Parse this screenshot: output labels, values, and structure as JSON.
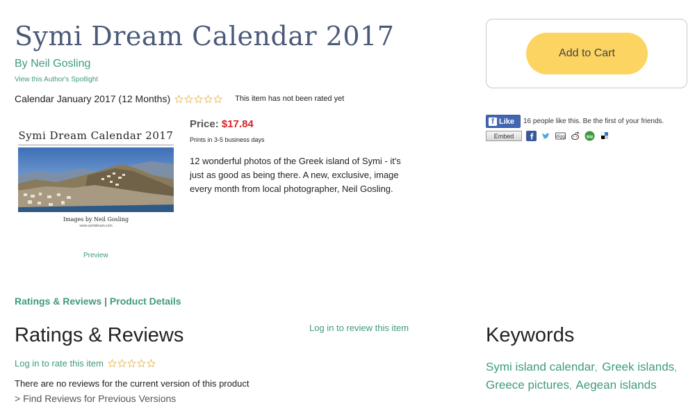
{
  "product": {
    "title": "Symi Dream Calendar 2017",
    "author_link": "By Neil Gosling",
    "spotlight_link": "View this Author's Spotlight",
    "format": "Calendar January 2017 (12 Months)",
    "rating_text": "This item has not been rated yet",
    "price_label": "Price:",
    "price_value": "$17.84",
    "prints_note": "Prints in 3-5 business days",
    "description": "12 wonderful photos of the Greek island of Symi - it's just as good as being there. A new, exclusive, image every month from local photographer, Neil Gosling."
  },
  "cover": {
    "title": "Symi Dream Calendar 2017",
    "credit": "Images by Neil Gosling",
    "url": "www.symidream.com",
    "preview_link": "Preview"
  },
  "cart": {
    "button_label": "Add to Cart",
    "color": "#fcd462"
  },
  "social": {
    "like_label": "Like",
    "like_text": "16 people like this. Be the first of your friends.",
    "embed_label": "Embed",
    "icons": [
      "facebook-icon",
      "twitter-icon",
      "digg-icon",
      "reddit-icon",
      "stumbleupon-icon",
      "delicious-icon"
    ]
  },
  "tabs": {
    "ratings": "Ratings & Reviews",
    "separator": "|",
    "details": "Product Details"
  },
  "reviews": {
    "heading": "Ratings & Reviews",
    "login_review": "Log in to review this item",
    "login_rate": "Log in to rate this item",
    "no_reviews": "There are no reviews for the current version of this product",
    "find_previous": "> Find Reviews for Previous Versions"
  },
  "keywords": {
    "heading": "Keywords",
    "items": [
      "Symi island calendar",
      "Greek islands",
      "Greece pictures",
      "Aegean islands"
    ]
  },
  "colors": {
    "accent": "#3e9a7e",
    "title": "#4a5a78",
    "price": "#d8232a",
    "star_outline": "#e8b64a"
  }
}
